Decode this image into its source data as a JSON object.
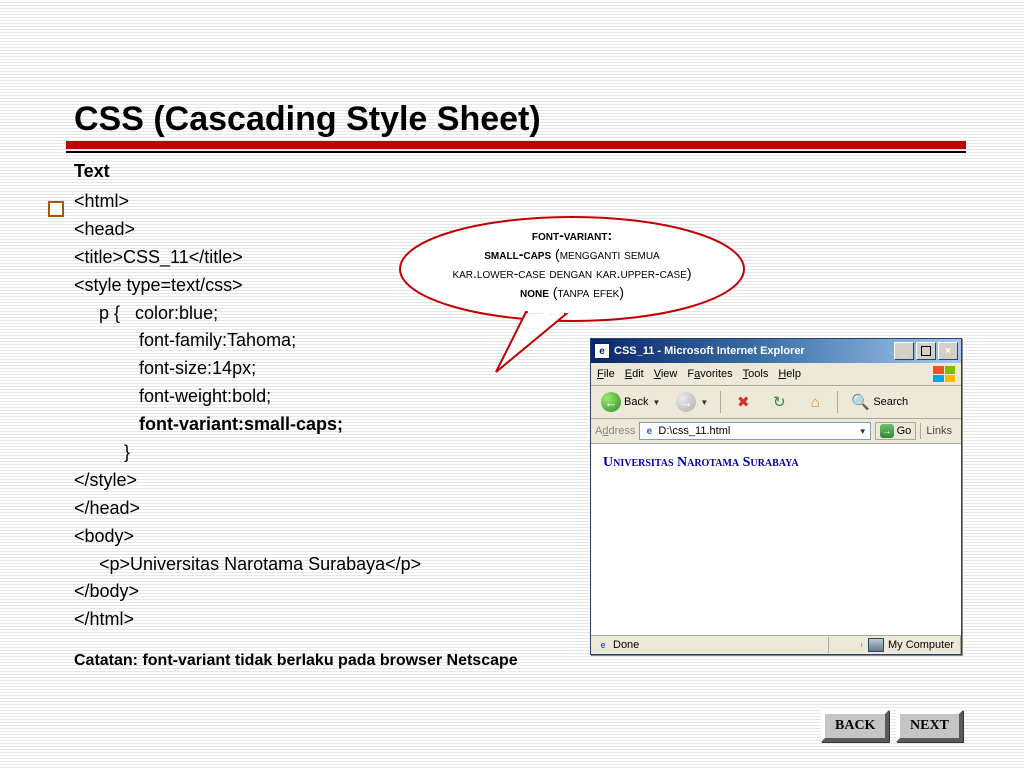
{
  "title": "CSS (Cascading Style Sheet)",
  "section_heading": "Text",
  "code": {
    "l1": "<html>",
    "l2": "<head>",
    "l3": "<title>CSS_11</title>",
    "l4": "<style type=text/css>",
    "l5": "     p {   color:blue;",
    "l6": "             font-family:Tahoma;",
    "l7": "             font-size:14px;",
    "l8": "             font-weight:bold;",
    "l9": "             font-variant:small-caps;",
    "l10": "          }",
    "l11": "</style>",
    "l12": "</head>",
    "l13": "<body>",
    "l14": "     <p>Universitas Narotama Surabaya</p>",
    "l15": "</body>",
    "l16": "</html>"
  },
  "bubble": {
    "line1a": "font-variant:",
    "line2a": "small-caps",
    "line2b": " (mengganti semua",
    "line3": "kar.lower-case dengan kar.upper-case)",
    "line4a": "none",
    "line4b": " (tanpa efek)"
  },
  "browser": {
    "title": "CSS_11 - Microsoft Internet Explorer",
    "menu": {
      "file": "File",
      "edit": "Edit",
      "view": "View",
      "fav": "Favorites",
      "tools": "Tools",
      "help": "Help"
    },
    "toolbar": {
      "back": "Back",
      "search": "Search"
    },
    "address_label": "Address",
    "address_value": "D:\\css_11.html",
    "go": "Go",
    "links": "Links",
    "page_text": "Universitas Narotama Surabaya",
    "status_done": "Done",
    "status_zone": "My Computer"
  },
  "catatan": "Catatan: font-variant tidak berlaku pada browser Netscape",
  "nav": {
    "back": "BACK",
    "next": "NEXT"
  }
}
